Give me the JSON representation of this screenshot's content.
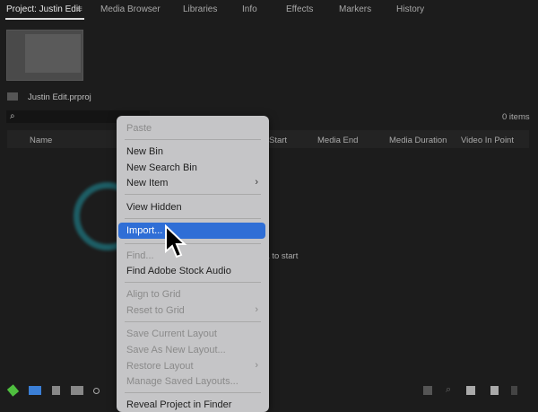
{
  "tabs": [
    {
      "label": "Project: Justin Edit"
    },
    {
      "label": "Media Browser"
    },
    {
      "label": "Libraries"
    },
    {
      "label": "Info"
    },
    {
      "label": "Effects"
    },
    {
      "label": "Markers"
    },
    {
      "label": "History"
    }
  ],
  "project": {
    "file": "Justin Edit.prproj",
    "item_count": "0 items",
    "empty_hint": "dia to start"
  },
  "columns": [
    "Name",
    "Start",
    "Media End",
    "Media Duration",
    "Video In Point"
  ],
  "menu": {
    "items": [
      {
        "label": "Paste"
      },
      {
        "label": "New Bin"
      },
      {
        "label": "New Search Bin"
      },
      {
        "label": "New Item"
      },
      {
        "label": "View Hidden"
      },
      {
        "label": "Import..."
      },
      {
        "label": "Find..."
      },
      {
        "label": "Find Adobe Stock Audio"
      },
      {
        "label": "Align to Grid"
      },
      {
        "label": "Reset to Grid"
      },
      {
        "label": "Save Current Layout"
      },
      {
        "label": "Save As New Layout..."
      },
      {
        "label": "Restore Layout"
      },
      {
        "label": "Manage Saved Layouts..."
      },
      {
        "label": "Reveal Project in Finder"
      }
    ]
  },
  "colors": {
    "accent": "#2f6ed6",
    "ring": "#1f8a96",
    "menu_bg": "#c5c5c7"
  }
}
